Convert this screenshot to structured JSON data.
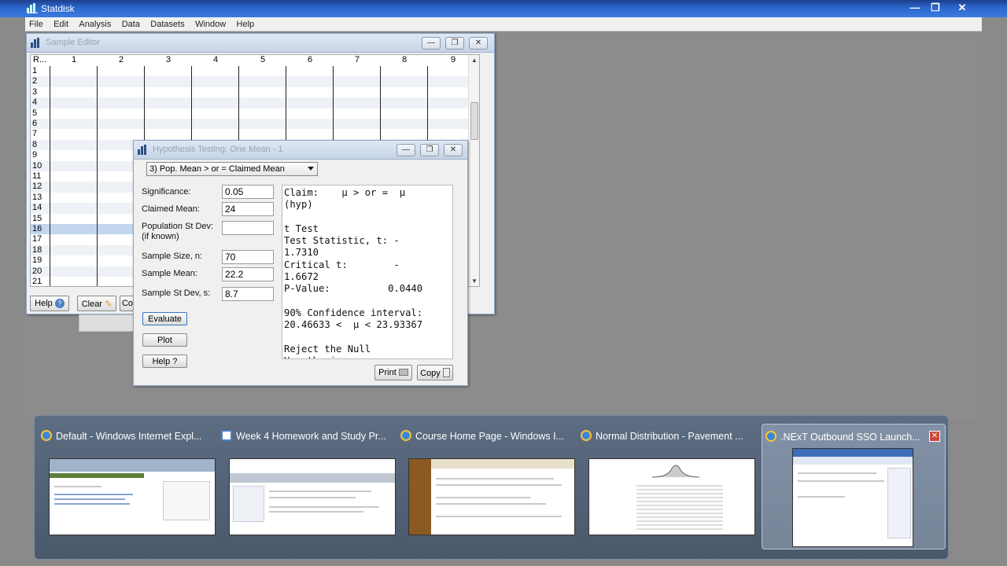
{
  "app": {
    "title": "Statdisk",
    "min": "—",
    "max": "❐",
    "close": "✕"
  },
  "menu": [
    "File",
    "Edit",
    "Analysis",
    "Data",
    "Datasets",
    "Window",
    "Help"
  ],
  "sample_editor": {
    "title": "Sample Editor",
    "row_header": "R...",
    "columns": [
      "1",
      "2",
      "3",
      "4",
      "5",
      "6",
      "7",
      "8",
      "9"
    ],
    "rows": [
      "1",
      "2",
      "3",
      "4",
      "5",
      "6",
      "7",
      "8",
      "9",
      "10",
      "11",
      "12",
      "13",
      "14",
      "15",
      "16",
      "17",
      "18",
      "19",
      "20",
      "21"
    ],
    "selected_row": "16",
    "buttons": {
      "help": "Help",
      "clear": "Clear",
      "co": "Co"
    }
  },
  "hypothesis": {
    "title": "Hypothesis Testing: One Mean - 1",
    "claim_option": "3) Pop. Mean > or = Claimed Mean",
    "fields": {
      "significance_label": "Significance:",
      "significance": "0.05",
      "claimed_mean_label": "Claimed Mean:",
      "claimed_mean": "24",
      "pop_sd_label": "Population St Dev:",
      "pop_sd_sub": "(if known)",
      "pop_sd": "",
      "n_label": "Sample Size, n:",
      "n": "70",
      "mean_label": "Sample Mean:",
      "mean": "22.2",
      "sd_label": "Sample St Dev, s:",
      "sd": "8.7"
    },
    "buttons": {
      "evaluate": "Evaluate",
      "plot": "Plot",
      "help": "Help ?",
      "print": "Print",
      "copy": "Copy"
    },
    "output": "Claim:    μ > or =  μ\n(hyp)\n\nt Test\nTest Statistic, t: -\n1.7310\nCritical t:        -\n1.6672\nP-Value:          0.0440\n\n90% Confidence interval:\n20.46633 <  μ < 23.93367\n\nReject the Null\nHypothesis"
  },
  "taskbar": [
    {
      "title": "Default - Windows Internet Expl...",
      "icon": "ie-icon"
    },
    {
      "title": "Week 4 Homework and Study Pr...",
      "icon": "page-icon"
    },
    {
      "title": "Course Home Page - Windows I...",
      "icon": "ie-icon"
    },
    {
      "title": "Normal Distribution - Pavement ...",
      "icon": "ie-icon"
    },
    {
      "title": ".NExT Outbound SSO Launch...",
      "icon": "ie-icon",
      "close": "✕"
    }
  ]
}
